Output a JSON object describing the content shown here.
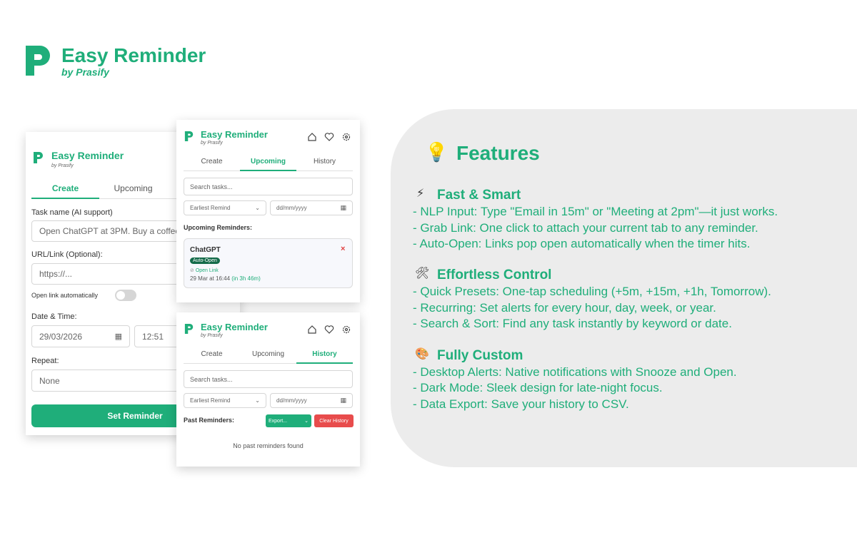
{
  "brand": {
    "title": "Easy Reminder",
    "subtitle": "by Prasify",
    "accent": "#1fae7a"
  },
  "create_panel": {
    "title": "Easy Reminder",
    "subtitle": "by Prasify",
    "tabs": [
      "Create",
      "Upcoming"
    ],
    "task_label": "Task name (AI support)",
    "task_placeholder": "Open ChatGPT at 3PM. Buy a coffee in",
    "url_label": "URL/Link (Optional):",
    "url_placeholder": "https://...",
    "open_auto_label": "Open link automatically",
    "datetime_label": "Date & Time:",
    "date_value": "29/03/2026",
    "time_value": "12:51",
    "repeat_label": "Repeat:",
    "repeat_value": "None",
    "submit_label": "Set Reminder"
  },
  "upcoming_panel": {
    "title": "Easy Reminder",
    "subtitle": "by Prasify",
    "tabs": [
      "Create",
      "Upcoming",
      "History"
    ],
    "search_placeholder": "Search tasks...",
    "sort_value": "Earliest Remind",
    "date_placeholder": "dd/mm/yyyy",
    "section_label": "Upcoming Reminders:",
    "reminder": {
      "title": "ChatGPT",
      "badge": "Auto-Open",
      "link": "Open Link",
      "time": "29 Mar at 16:44",
      "relative": "(in 3h 46m)",
      "close": "×"
    }
  },
  "history_panel": {
    "title": "Easy Reminder",
    "subtitle": "by Prasify",
    "tabs": [
      "Create",
      "Upcoming",
      "History"
    ],
    "search_placeholder": "Search tasks...",
    "sort_value": "Earliest Remind",
    "date_placeholder": "dd/mm/yyyy",
    "section_label": "Past Reminders:",
    "export_label": "Export...",
    "clear_label": "Clear History",
    "empty_text": "No past reminders found"
  },
  "features": {
    "title": "Features",
    "sections": [
      {
        "heading": "Fast & Smart",
        "items": [
          "- NLP Input: Type \"Email in 15m\" or \"Meeting at 2pm\"—it just works.",
          "- Grab Link: One click to attach your current tab to any reminder.",
          "- Auto-Open: Links pop open automatically when the timer hits."
        ]
      },
      {
        "heading": "Effortless Control",
        "items": [
          "- Quick Presets: One-tap scheduling (+5m, +15m, +1h, Tomorrow).",
          "- Recurring: Set alerts for every hour, day, week, or year.",
          "- Search & Sort: Find any task instantly by keyword or date."
        ]
      },
      {
        "heading": "Fully Custom",
        "items": [
          "- Desktop Alerts: Native notifications with Snooze and Open.",
          "- Dark Mode: Sleek design for late-night focus.",
          "- Data Export: Save your history to CSV."
        ]
      }
    ]
  }
}
